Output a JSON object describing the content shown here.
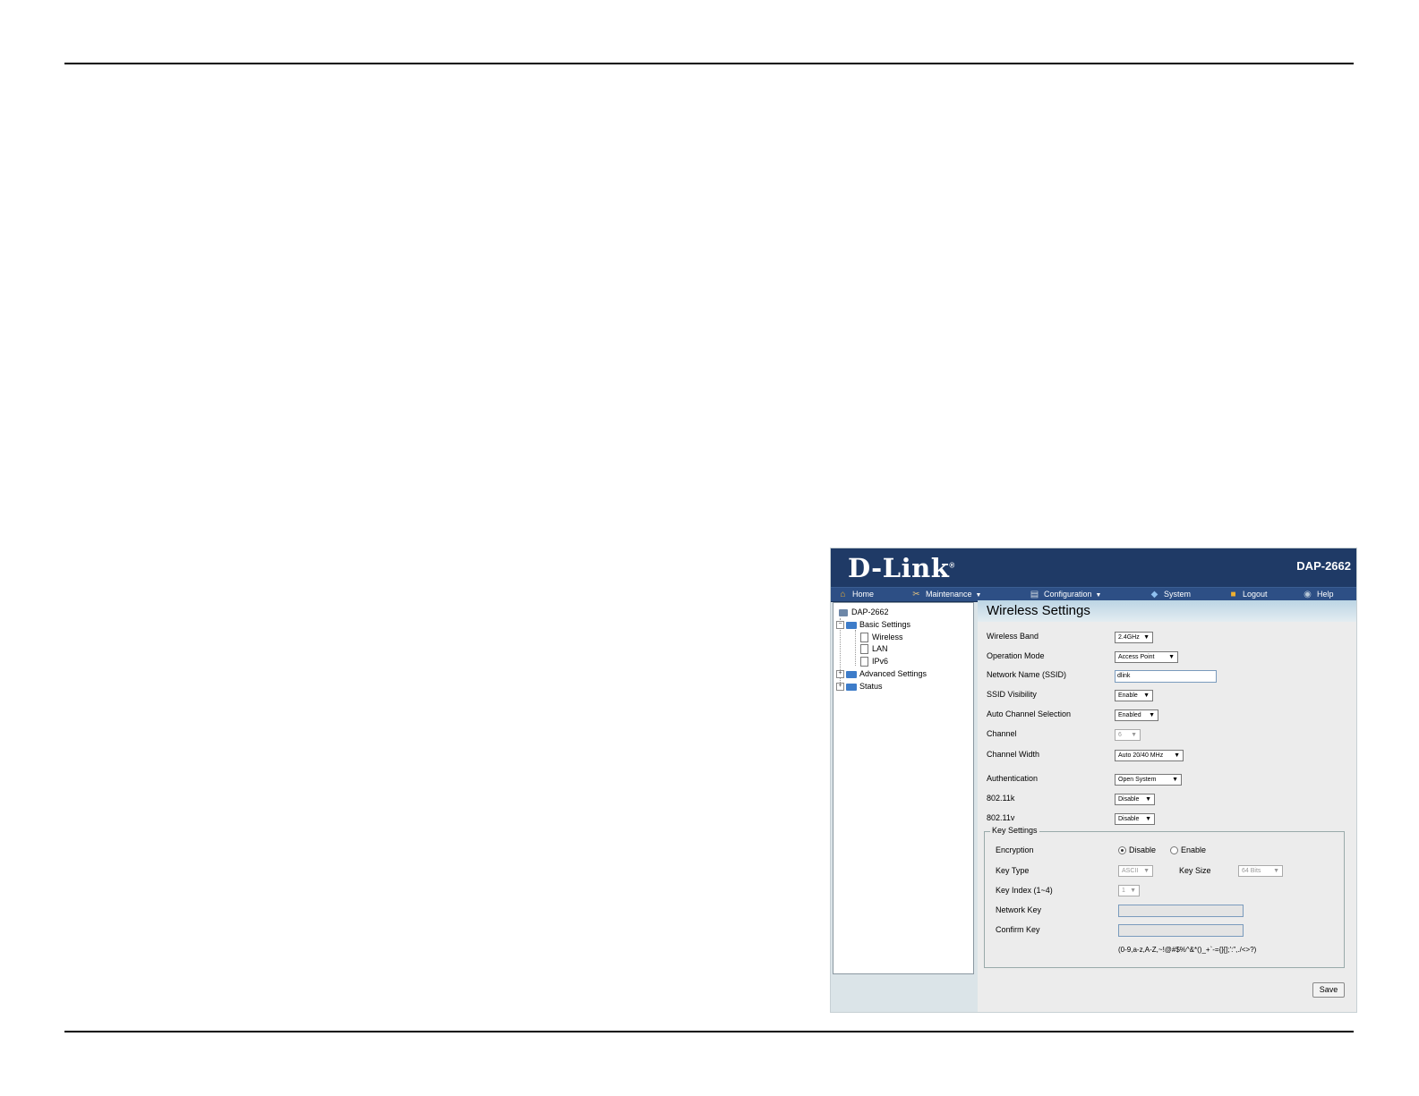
{
  "header": {
    "brand": "D-Link",
    "model": "DAP-2662"
  },
  "menu": [
    {
      "label": "Home",
      "icon": "home-icon"
    },
    {
      "label": "Maintenance",
      "icon": "tools-icon"
    },
    {
      "label": "Configuration",
      "icon": "configuration-icon"
    },
    {
      "label": "System",
      "icon": "system-icon"
    },
    {
      "label": "Logout",
      "icon": "logout-icon"
    },
    {
      "label": "Help",
      "icon": "help-icon"
    }
  ],
  "tree": {
    "root": "DAP-2662",
    "basic": "Basic Settings",
    "wireless": "Wireless",
    "lan": "LAN",
    "ipv6": "IPv6",
    "advanced": "Advanced Settings",
    "status": "Status"
  },
  "form": {
    "title": "Wireless Settings",
    "wireless_band": {
      "label": "Wireless Band",
      "value": "2.4GHz"
    },
    "operation_mode": {
      "label": "Operation Mode",
      "value": "Access Point"
    },
    "ssid": {
      "label": "Network Name (SSID)",
      "value": "dlink"
    },
    "ssid_visibility": {
      "label": "SSID Visibility",
      "value": "Enable"
    },
    "auto_channel": {
      "label": "Auto Channel Selection",
      "value": "Enabled"
    },
    "channel": {
      "label": "Channel",
      "value": "6"
    },
    "channel_width": {
      "label": "Channel Width",
      "value": "Auto 20/40 MHz"
    },
    "authentication": {
      "label": "Authentication",
      "value": "Open System"
    },
    "dot11k": {
      "label": "802.11k",
      "value": "Disable"
    },
    "dot11v": {
      "label": "802.11v",
      "value": "Disable"
    }
  },
  "key_settings": {
    "legend": "Key Settings",
    "encryption": {
      "label": "Encryption",
      "disable": "Disable",
      "enable": "Enable",
      "selected": "Disable"
    },
    "key_type": {
      "label": "Key Type",
      "value": "ASCII"
    },
    "key_size": {
      "label": "Key Size",
      "value": "64 Bits"
    },
    "key_index": {
      "label": "Key Index (1~4)",
      "value": "1"
    },
    "network_key": {
      "label": "Network Key",
      "value": ""
    },
    "confirm_key": {
      "label": "Confirm Key",
      "value": ""
    },
    "hint": "(0-9,a-z,A-Z,~!@#$%^&*()_+`-={}[];':\",./<>?)"
  },
  "save_label": "Save",
  "colors": {
    "banner": "#1f3a66",
    "menubar": "#2d4f85",
    "content_bg": "#ececec",
    "panel_bg": "#dbe4e8"
  }
}
